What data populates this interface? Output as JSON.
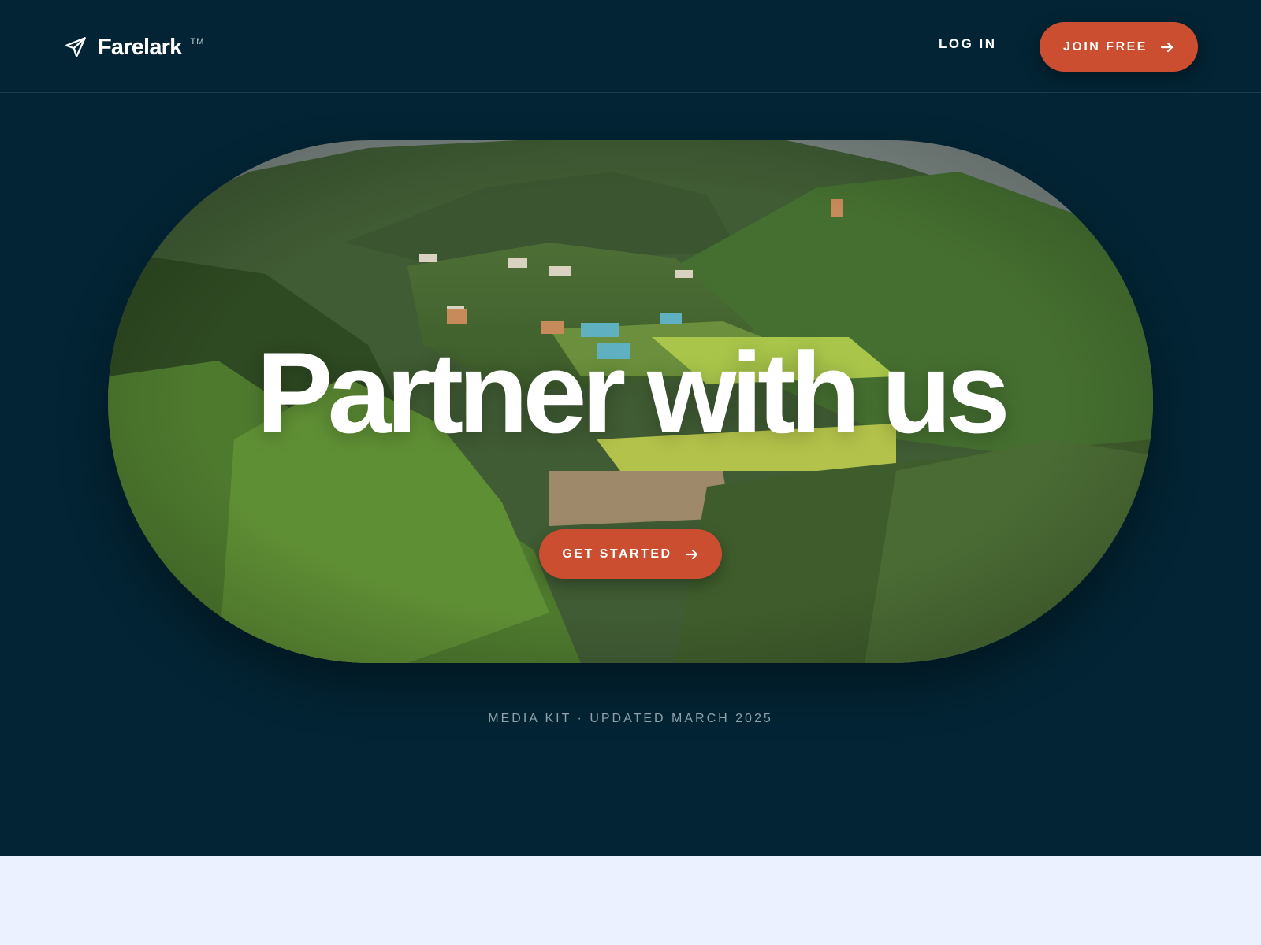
{
  "header": {
    "brand": "Farelark",
    "trademark": "TM",
    "login_label": "LOG IN",
    "join_label": "JOIN FREE"
  },
  "hero": {
    "title": "Partner with us",
    "cta_label": "GET STARTED",
    "image_description": "green terraced mountain valley with village houses"
  },
  "footer_note": "MEDIA KIT · UPDATED MARCH 2025",
  "icons": {
    "logo": "paper-plane-icon",
    "join_arrow": "arrow-right-icon",
    "cta_arrow": "arrow-right-icon"
  },
  "colors": {
    "background_dark": "#032434",
    "accent": "#cc4e30",
    "page_light": "#ebf1fe",
    "muted_text": "#8fa1ab"
  }
}
